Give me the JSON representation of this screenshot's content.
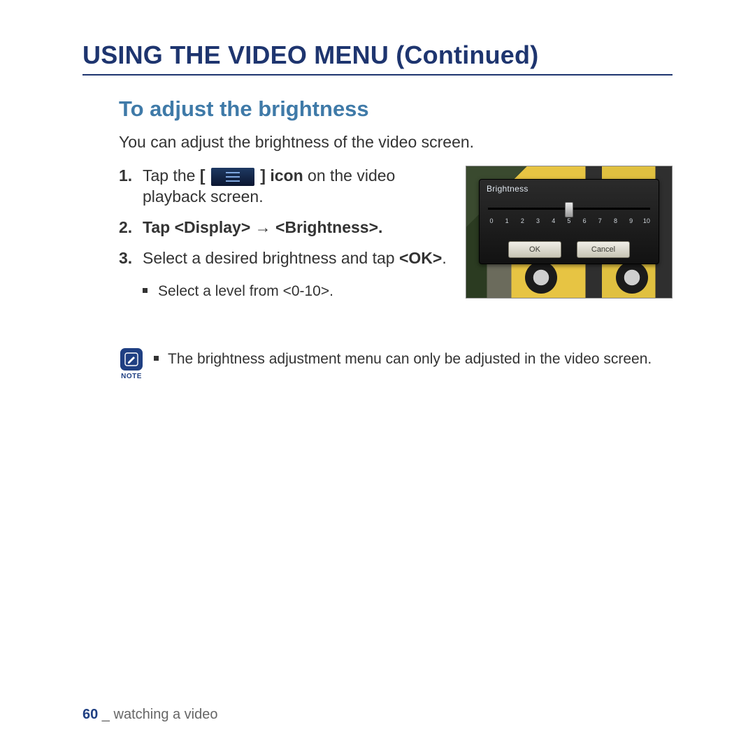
{
  "heading": "USING THE VIDEO MENU (Continued)",
  "subheading": "To adjust the brightness",
  "intro": "You can adjust the brightness of the video screen.",
  "steps": {
    "s1a": "Tap the ",
    "s1b_bold": "[",
    "s1c_bold": "] icon",
    "s1d": " on the video playback screen.",
    "s2_bold": "Tap <Display> → <Brightness>.",
    "s3a": "Select a desired brightness and tap ",
    "s3b_bold": "<OK>",
    "s3c": ".",
    "sub1": "Select a level from <0-10>."
  },
  "nums": {
    "n1": "1.",
    "n2": "2.",
    "n3": "3."
  },
  "screenshot": {
    "panel_title": "Brightness",
    "ticks": [
      "0",
      "1",
      "2",
      "3",
      "4",
      "5",
      "6",
      "7",
      "8",
      "9",
      "10"
    ],
    "ok": "OK",
    "cancel": "Cancel"
  },
  "note": {
    "label": "NOTE",
    "text": "The brightness adjustment menu can only be adjusted in the video screen."
  },
  "footer": {
    "page": "60",
    "sep": " _ ",
    "section": "watching a video"
  }
}
